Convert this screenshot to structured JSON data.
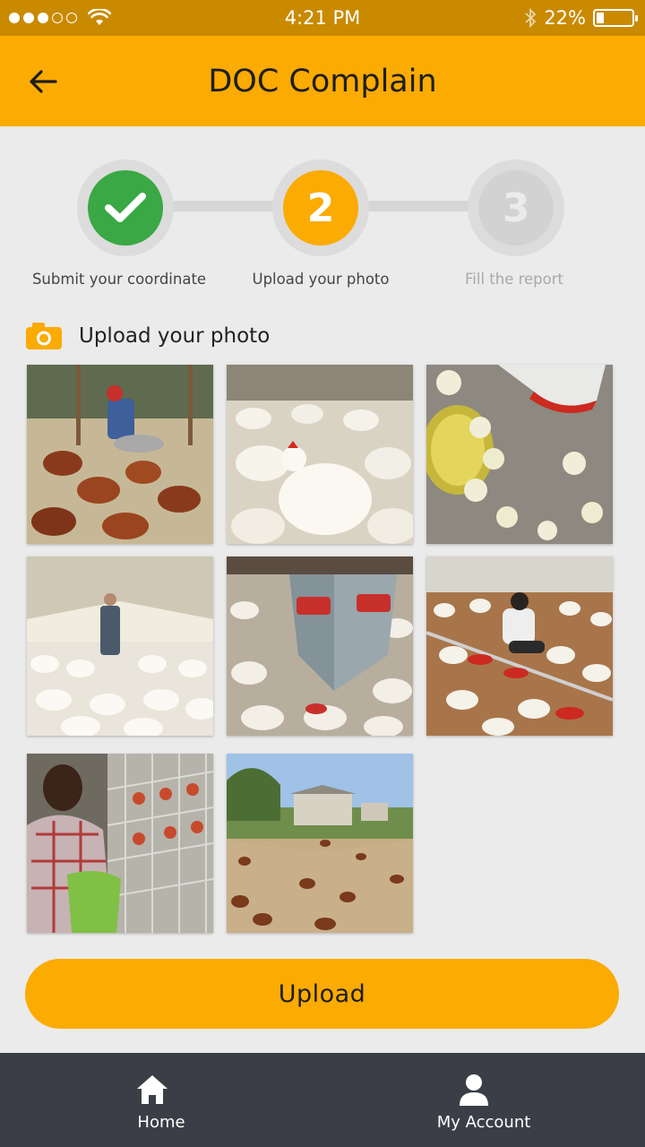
{
  "status_bar": {
    "time": "4:21 PM",
    "battery_text": "22%",
    "battery_level": 0.22,
    "signal_bars_filled": 3,
    "signal_bars_total": 5
  },
  "header": {
    "title": "DOC Complain",
    "back_icon": "arrow-left-icon"
  },
  "stepper": {
    "steps": [
      {
        "number": "1",
        "label": "Submit your coordinate",
        "state": "done"
      },
      {
        "number": "2",
        "label": "Upload your photo",
        "state": "active"
      },
      {
        "number": "3",
        "label": "Fill the report",
        "state": "pending"
      }
    ]
  },
  "section": {
    "title": "Upload your photo",
    "icon": "camera-icon"
  },
  "photos": {
    "count": 8,
    "items": [
      "poultry-farmer-feeding-hens",
      "white-broiler-chickens-closeup",
      "chicks-at-feeder",
      "farmer-in-broiler-house",
      "automatic-feeder-with-broilers",
      "worker-crouching-among-chickens",
      "man-at-battery-cages",
      "free-range-hens-on-farm"
    ]
  },
  "upload_button": {
    "label": "Upload"
  },
  "bottom_nav": {
    "items": [
      {
        "label": "Home",
        "icon": "home-icon"
      },
      {
        "label": "My Account",
        "icon": "user-icon"
      }
    ]
  },
  "colors": {
    "status_bar": "#c98a00",
    "accent": "#fbab01",
    "success": "#39a845",
    "background": "#ebebeb",
    "nav_background": "#3c3e47"
  }
}
